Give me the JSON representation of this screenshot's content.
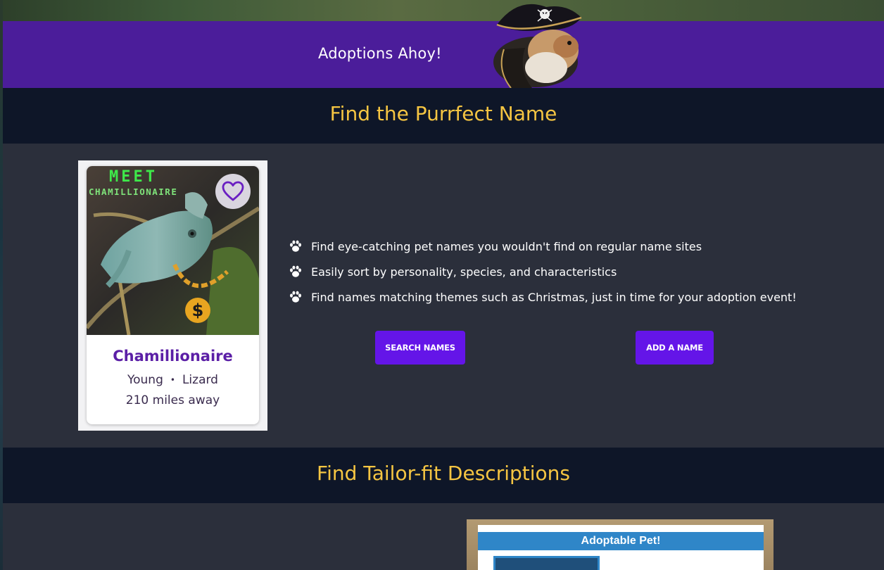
{
  "banner": {
    "title": "Adoptions Ahoy!",
    "mascot_icon": "pirate-guinea-pig",
    "color": "#4b1d9a"
  },
  "names_section": {
    "heading": "Find the Purrfect Name",
    "pet_card": {
      "photo_caption_line1": "MEET",
      "photo_caption_line2": "CHAMILLIONAIRE",
      "name": "Chamillionaire",
      "age": "Young",
      "species": "Lizard",
      "distance": "210 miles away",
      "favorite_icon": "heart-outline-icon"
    },
    "features": [
      "Find eye-catching pet names you wouldn't find on regular name sites",
      "Easily sort by personality, species, and characteristics",
      "Find names matching themes such as Christmas, just in time for your adoption event!"
    ],
    "feature_icon": "paw-icon",
    "buttons": {
      "search": "Search Names",
      "add": "Add a Name"
    }
  },
  "descriptions_section": {
    "heading": "Find Tailor-fit Descriptions",
    "poster_header": "Adoptable Pet!"
  },
  "colors": {
    "accent_yellow": "#f5c542",
    "button_purple": "#6415e8",
    "header_navy": "#0e1628",
    "body_slate": "#2b2f3b",
    "pet_name_purple": "#5b1fa6"
  }
}
